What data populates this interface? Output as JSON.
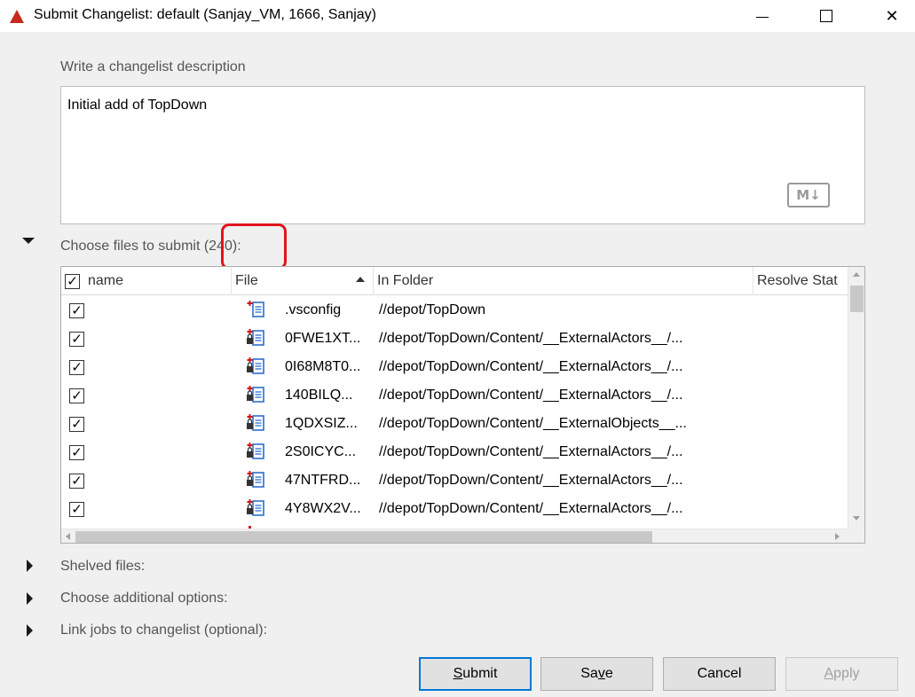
{
  "window": {
    "title": "Submit Changelist: default (Sanjay_VM,  1666,  Sanjay)",
    "controls": {
      "minimize": "minimize",
      "maximize": "maximize",
      "close": "✕"
    }
  },
  "description": {
    "label": "Write a changelist description",
    "value": "Initial add of TopDown",
    "markdown_badge": "M↓"
  },
  "files_section": {
    "label": "Choose files to submit (240):",
    "count": 240,
    "columns": {
      "name": "name",
      "file": "File",
      "folder": "In Folder",
      "resolve": "Resolve Stat"
    },
    "header_checked": "✓",
    "rows": [
      {
        "checked": "✓",
        "icon": "add-file-icon",
        "file": ".vsconfig",
        "folder": "//depot/TopDown"
      },
      {
        "checked": "✓",
        "icon": "add-locked-file-icon",
        "file": "0FWE1XT...",
        "folder": "//depot/TopDown/Content/__ExternalActors__/..."
      },
      {
        "checked": "✓",
        "icon": "add-locked-file-icon",
        "file": "0I68M8T0...",
        "folder": "//depot/TopDown/Content/__ExternalActors__/..."
      },
      {
        "checked": "✓",
        "icon": "add-locked-file-icon",
        "file": "140BILQ...",
        "folder": "//depot/TopDown/Content/__ExternalActors__/..."
      },
      {
        "checked": "✓",
        "icon": "add-locked-file-icon",
        "file": "1QDXSIZ...",
        "folder": "//depot/TopDown/Content/__ExternalObjects__..."
      },
      {
        "checked": "✓",
        "icon": "add-locked-file-icon",
        "file": "2S0ICYC...",
        "folder": "//depot/TopDown/Content/__ExternalActors__/..."
      },
      {
        "checked": "✓",
        "icon": "add-locked-file-icon",
        "file": "47NTFRD...",
        "folder": "//depot/TopDown/Content/__ExternalActors__/..."
      },
      {
        "checked": "✓",
        "icon": "add-locked-file-icon",
        "file": "4Y8WX2V...",
        "folder": "//depot/TopDown/Content/__ExternalActors__/..."
      }
    ]
  },
  "sections": {
    "shelved": "Shelved files:",
    "additional_options": "Choose additional options:",
    "link_jobs": "Link jobs to changelist (optional):"
  },
  "buttons": {
    "submit": "Submit",
    "save": "Save",
    "cancel": "Cancel",
    "apply": "Apply"
  },
  "colors": {
    "accent": "#0078d7",
    "highlight": "#e0141b",
    "add_marker": "#d01818",
    "file_icon": "#2b6fcf"
  }
}
